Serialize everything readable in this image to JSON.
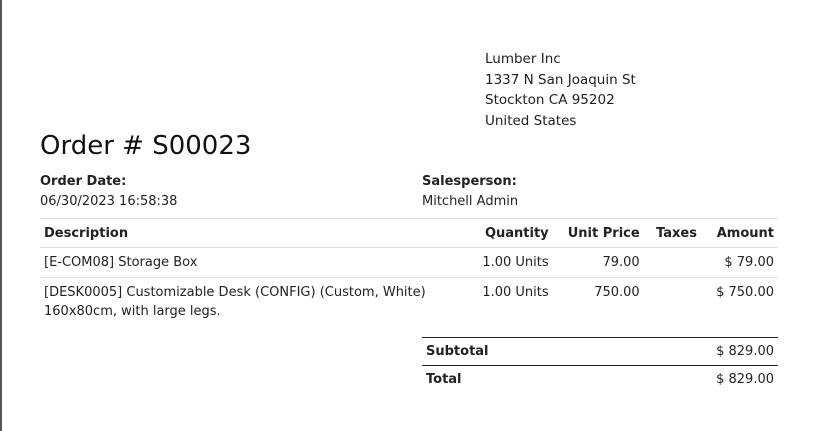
{
  "company": {
    "name": "Lumber Inc",
    "street": "1337 N San Joaquin St",
    "city": "Stockton CA 95202",
    "country": "United States"
  },
  "order": {
    "title": "Order # S00023",
    "date_label": "Order Date:",
    "date_value": "06/30/2023 16:58:38",
    "salesperson_label": "Salesperson:",
    "salesperson_value": "Mitchell Admin"
  },
  "table": {
    "headers": {
      "description": "Description",
      "quantity": "Quantity",
      "unit_price": "Unit Price",
      "taxes": "Taxes",
      "amount": "Amount"
    },
    "rows": [
      {
        "description": "[E-COM08] Storage Box",
        "quantity": "1.00 Units",
        "unit_price": "79.00",
        "taxes": "",
        "amount": "$ 79.00"
      },
      {
        "description": "[DESK0005] Customizable Desk (CONFIG) (Custom, White) 160x80cm, with large legs.",
        "quantity": "1.00 Units",
        "unit_price": "750.00",
        "taxes": "",
        "amount": "$ 750.00"
      }
    ]
  },
  "totals": {
    "subtotal_label": "Subtotal",
    "subtotal_value": "$ 829.00",
    "total_label": "Total",
    "total_value": "$ 829.00"
  }
}
